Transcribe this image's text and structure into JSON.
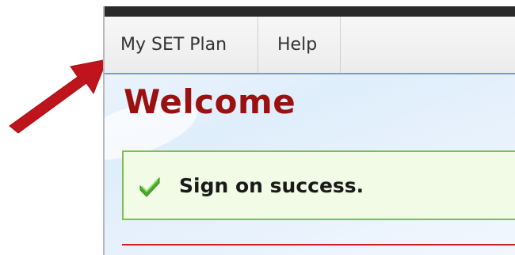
{
  "menu": {
    "items": [
      {
        "label": "My SET Plan"
      },
      {
        "label": "Help"
      }
    ]
  },
  "page": {
    "heading": "Welcome"
  },
  "alert": {
    "message": "Sign on success.",
    "icon": "checkmark-icon"
  },
  "annotation": {
    "icon": "arrow-icon",
    "color": "#c0141c"
  },
  "colors": {
    "heading": "#9b1010",
    "success_border": "#7cbf4a",
    "success_bg": "#f2fbe6",
    "rule": "#c8202a"
  }
}
